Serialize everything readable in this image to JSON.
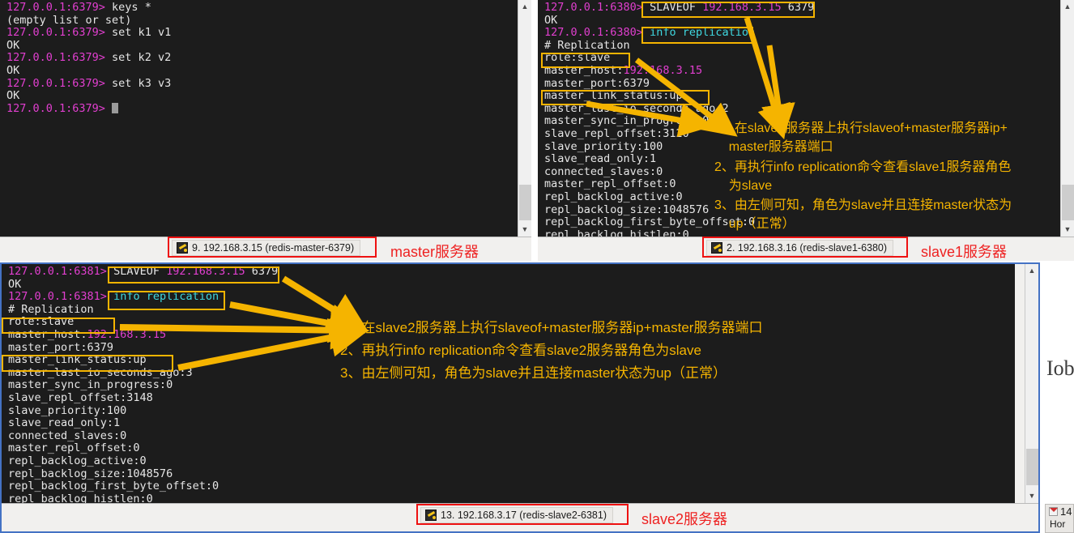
{
  "colors": {
    "terminal_bg": "#1c1c1c",
    "prompt_magenta": "#e23fd0",
    "cmd_cyan": "#3fd8e0",
    "highlight_yellow": "#f5b400",
    "annotation_red": "#ee2222",
    "panel_border_blue": "#4472c4"
  },
  "master_panel": {
    "name": "redis-master-6379",
    "lines": [
      {
        "prompt": "127.0.0.1:6379>",
        "cmd": " keys *"
      },
      {
        "out": "(empty list or set)"
      },
      {
        "prompt": "127.0.0.1:6379>",
        "cmd": " set k1 v1"
      },
      {
        "out": "OK"
      },
      {
        "prompt": "127.0.0.1:6379>",
        "cmd": " set k2 v2"
      },
      {
        "out": "OK"
      },
      {
        "prompt": "127.0.0.1:6379>",
        "cmd": " set k3 v3"
      },
      {
        "out": "OK"
      },
      {
        "prompt": "127.0.0.1:6379>",
        "cmd": " ",
        "cursor": true
      }
    ],
    "taskbar_label": "9. 192.168.3.15 (redis-master-6379)",
    "role_label": "master服务器"
  },
  "slave1_panel": {
    "name": "redis-slave1-6380",
    "lines": [
      {
        "prompt": "127.0.0.1:6380>",
        "cmd": " ",
        "hl_cmd": "SLAVEOF ",
        "hl_ip": "192.168.3.15",
        "hl_tail": " 6379"
      },
      {
        "out": "OK"
      },
      {
        "prompt": "127.0.0.1:6380>",
        "cmd": " ",
        "hl_cyan": "info replication"
      },
      {
        "out": "# Replication"
      },
      {
        "out": "role:slave"
      },
      {
        "out": "master_host:",
        "magenta": "192.168.3.15"
      },
      {
        "out": "master_port:6379"
      },
      {
        "out": "master_link_status:up"
      },
      {
        "out": "master_last_io_seconds_ago:2"
      },
      {
        "out": "master_sync_in_progress:0"
      },
      {
        "out": "slave_repl_offset:3120"
      },
      {
        "out": "slave_priority:100"
      },
      {
        "out": "slave_read_only:1"
      },
      {
        "out": "connected_slaves:0"
      },
      {
        "out": "master_repl_offset:0"
      },
      {
        "out": "repl_backlog_active:0"
      },
      {
        "out": "repl_backlog_size:1048576"
      },
      {
        "out": "repl_backlog_first_byte_offset:0"
      },
      {
        "out": "repl_backlog_histlen:0"
      }
    ],
    "notes": [
      "1、在slave1服务器上执行slaveof+master服务器ip+",
      "    master服务器端口",
      "2、再执行info replication命令查看slave1服务器角色",
      "    为slave",
      "3、由左侧可知，角色为slave并且连接master状态为",
      "    up（正常）"
    ],
    "taskbar_label": "2. 192.168.3.16 (redis-slave1-6380)",
    "role_label": "slave1服务器"
  },
  "slave2_panel": {
    "name": "redis-slave2-6381",
    "lines": [
      {
        "prompt": "127.0.0.1:6381>",
        "cmd": " ",
        "hl_cmd": "SLAVEOF ",
        "hl_ip": "192.168.3.15",
        "hl_tail": " 6379"
      },
      {
        "out": "OK"
      },
      {
        "prompt": "127.0.0.1:6381>",
        "cmd": " ",
        "hl_cyan": "info replication"
      },
      {
        "out": "# Replication"
      },
      {
        "out": "role:slave"
      },
      {
        "out": "master_host:",
        "magenta": "192.168.3.15"
      },
      {
        "out": "master_port:6379"
      },
      {
        "out": "master_link_status:up"
      },
      {
        "out": "master_last_io_seconds_ago:3"
      },
      {
        "out": "master_sync_in_progress:0"
      },
      {
        "out": "slave_repl_offset:3148"
      },
      {
        "out": "slave_priority:100"
      },
      {
        "out": "slave_read_only:1"
      },
      {
        "out": "connected_slaves:0"
      },
      {
        "out": "master_repl_offset:0"
      },
      {
        "out": "repl_backlog_active:0"
      },
      {
        "out": "repl_backlog_size:1048576"
      },
      {
        "out": "repl_backlog_first_byte_offset:0"
      },
      {
        "out": "repl_backlog_histlen:0"
      }
    ],
    "notes": [
      "1、在slave2服务器上执行slaveof+master服务器ip+master服务器端口",
      "2、再执行info replication命令查看slave2服务器角色为slave",
      "3、由左侧可知，角色为slave并且连接master状态为up（正常）"
    ],
    "taskbar_label": "13. 192.168.3.17 (redis-slave2-6381)",
    "role_label": "slave2服务器"
  },
  "edge": {
    "partial_text": "Iob",
    "partial_task_number": "14",
    "partial_task_label": "Hor"
  }
}
